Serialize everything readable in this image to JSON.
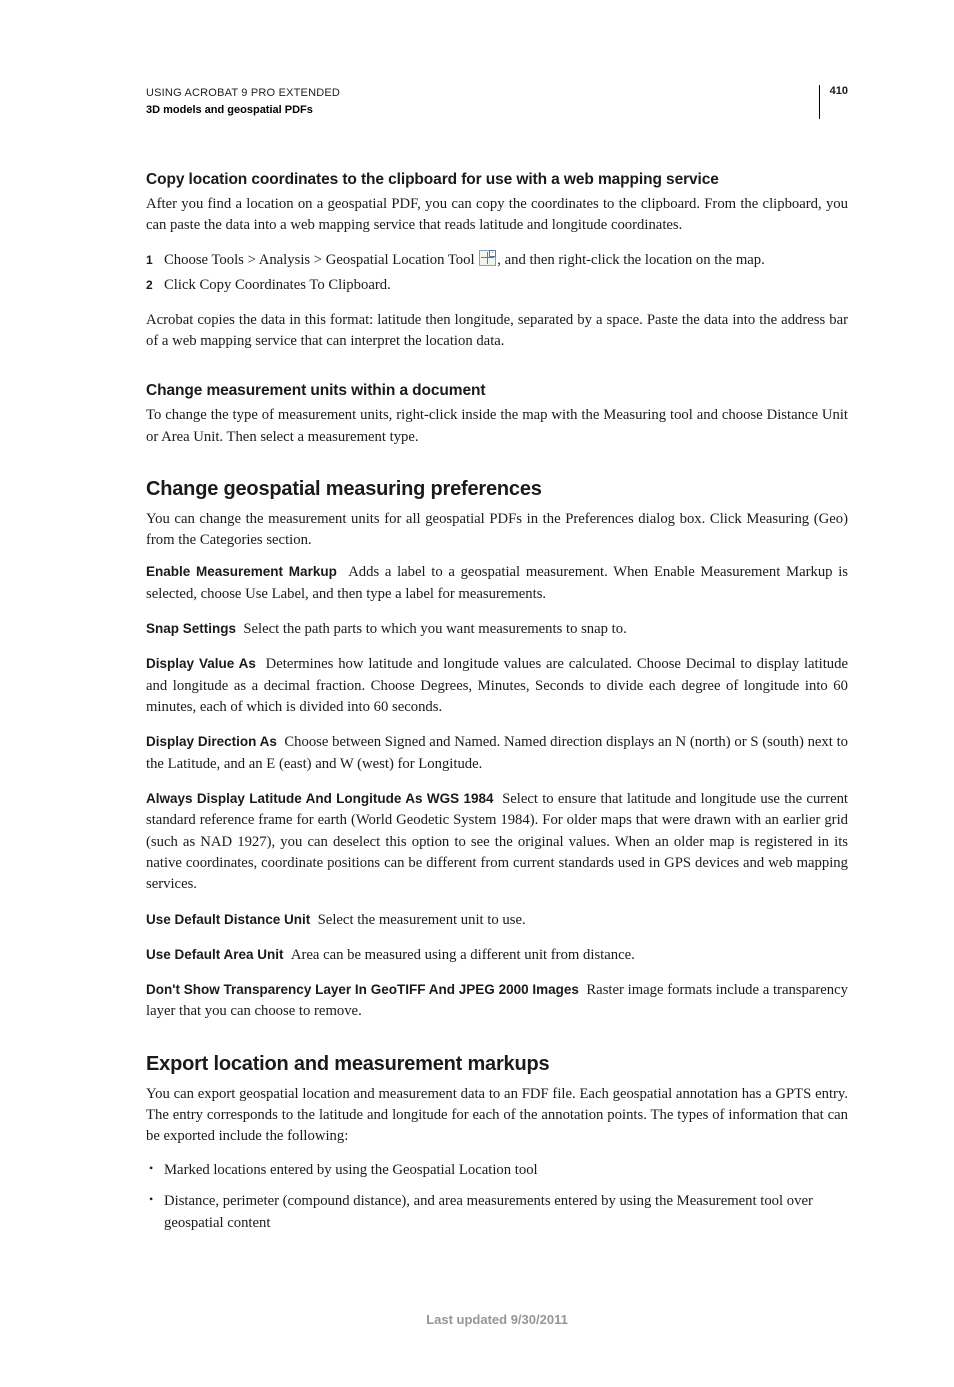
{
  "header": {
    "product": "USING ACROBAT 9 PRO EXTENDED",
    "section": "3D models and geospatial PDFs",
    "page": "410"
  },
  "s1": {
    "title": "Copy location coordinates to the clipboard for use with a web mapping service",
    "intro": "After you find a location on a geospatial PDF, you can copy the coordinates to the clipboard. From the clipboard, you can paste the data into a web mapping service that reads latitude and longitude coordinates.",
    "step1a": "Choose Tools > Analysis > Geospatial Location Tool ",
    "step1b": ", and then right-click the location on the map.",
    "step2": "Click Copy Coordinates To Clipboard.",
    "after": "Acrobat copies the data in this format: latitude then longitude, separated by a space. Paste the data into the address bar of a web mapping service that can interpret the location data."
  },
  "s2": {
    "title": "Change measurement units within a document",
    "body": "To change the type of measurement units, right-click inside the map with the Measuring tool and choose Distance Unit or Area Unit. Then select a measurement type."
  },
  "s3": {
    "title": "Change geospatial measuring preferences",
    "intro": "You can change the measurement units for all geospatial PDFs in the Preferences dialog box. Click Measuring (Geo) from the Categories section.",
    "defs": [
      {
        "term": "Enable Measurement Markup",
        "text": "Adds a label to a geospatial measurement. When Enable Measurement Markup is selected, choose Use Label, and then type a label for measurements."
      },
      {
        "term": "Snap Settings",
        "text": "Select the path parts to which you want measurements to snap to."
      },
      {
        "term": "Display Value As",
        "text": "Determines how latitude and longitude values are calculated. Choose Decimal to display latitude and longitude as a decimal fraction. Choose Degrees, Minutes, Seconds to divide each degree of longitude into 60 minutes, each of which is divided into 60 seconds."
      },
      {
        "term": "Display Direction As",
        "text": "Choose between Signed and Named. Named direction displays an N (north) or S (south) next to the Latitude, and an E (east) and W (west) for Longitude."
      },
      {
        "term": "Always Display Latitude And Longitude As WGS 1984",
        "text": "Select to ensure that latitude and longitude use the current standard reference frame for earth (World Geodetic System 1984). For older maps that were drawn with an earlier grid (such as NAD 1927), you can deselect this option to see the original values. When an older map is registered in its native coordinates, coordinate positions can be different from current standards used in GPS devices and web mapping services."
      },
      {
        "term": "Use Default Distance Unit",
        "text": "Select the measurement unit to use."
      },
      {
        "term": "Use Default Area Unit",
        "text": "Area can be measured using a different unit from distance."
      },
      {
        "term": "Don't Show Transparency Layer In GeoTIFF And JPEG 2000 Images",
        "text": "Raster image formats include a transparency layer that you can choose to remove."
      }
    ]
  },
  "s4": {
    "title": "Export location and measurement markups",
    "intro": "You can export geospatial location and measurement data to an FDF file. Each geospatial annotation has a GPTS entry. The entry corresponds to the latitude and longitude for each of the annotation points. The types of information that can be exported include the following:",
    "bullets": [
      "Marked locations entered by using the Geospatial Location tool",
      "Distance, perimeter (compound distance), and area measurements entered by using the Measurement tool over geospatial content"
    ]
  },
  "footer": "Last updated 9/30/2011"
}
